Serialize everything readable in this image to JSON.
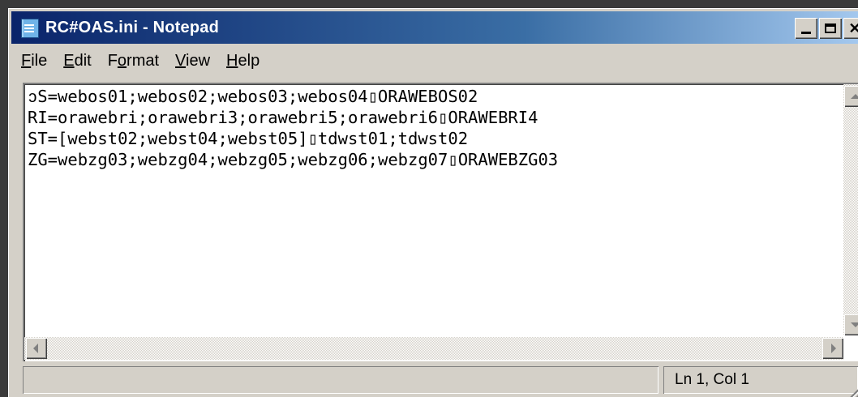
{
  "window": {
    "title": "RC#OAS.ini - Notepad"
  },
  "menu": [
    {
      "label": "File"
    },
    {
      "label": "Edit"
    },
    {
      "label": "Format"
    },
    {
      "label": "View"
    },
    {
      "label": "Help"
    }
  ],
  "editor": {
    "content": "ↄS=webos01;webos02;webos03;webos04▯ORAWEBOS02\nRI=orawebri;orawebri3;orawebri5;orawebri6▯ORAWEBRI4\nST=[webst02;webst04;webst05]▯tdwst01;tdwst02\nZG=webzg03;webzg04;webzg05;webzg06;webzg07▯ORAWEBZG03"
  },
  "status": {
    "position": "Ln 1, Col 1"
  },
  "icons": {
    "app": "notepad-icon",
    "minimize": "minimize-icon",
    "maximize": "maximize-icon",
    "close": "close-icon"
  }
}
